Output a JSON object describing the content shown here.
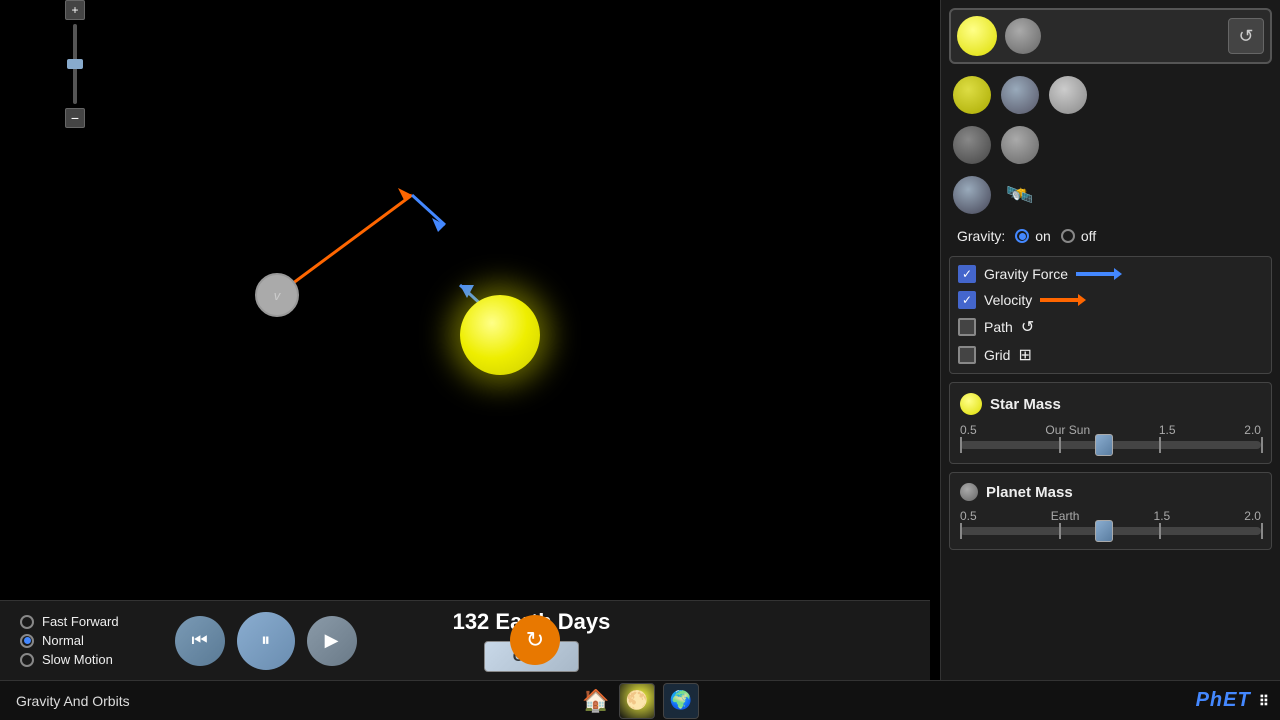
{
  "app": {
    "title": "Gravity And Orbits"
  },
  "simulation": {
    "time_display": "132 Earth Days"
  },
  "speed_options": [
    {
      "label": "Fast Forward",
      "selected": false
    },
    {
      "label": "Normal",
      "selected": true
    },
    {
      "label": "Slow Motion",
      "selected": false
    }
  ],
  "playback": {
    "rewind_label": "⏮",
    "pause_label": "⏸",
    "forward_label": "⏵"
  },
  "clear_button": "Clear",
  "gravity": {
    "label": "Gravity:",
    "on_label": "on",
    "off_label": "off",
    "on_selected": true
  },
  "checkboxes": [
    {
      "label": "Gravity Force",
      "checked": true,
      "arrow_type": "blue"
    },
    {
      "label": "Velocity",
      "checked": true,
      "arrow_type": "orange"
    },
    {
      "label": "Path",
      "checked": false,
      "icon": "↺"
    },
    {
      "label": "Grid",
      "checked": false,
      "icon": "⊞"
    }
  ],
  "star_mass": {
    "title": "Star Mass",
    "min": "0.5",
    "mid": "Our Sun",
    "max1": "1.5",
    "max2": "2.0",
    "thumb_pos_pct": 48
  },
  "planet_mass": {
    "title": "Planet Mass",
    "min": "0.5",
    "mid": "Earth",
    "max1": "1.5",
    "max2": "2.0",
    "thumb_pos_pct": 48
  },
  "planet_v_label": "v",
  "phet_logo": "PhET ⠿"
}
